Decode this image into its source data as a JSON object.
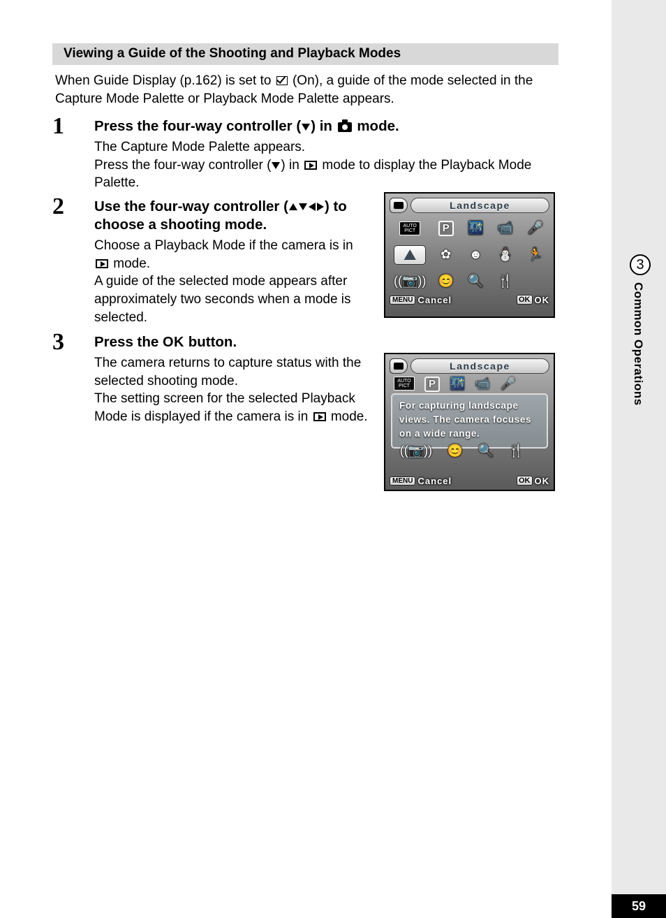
{
  "sideTab": {
    "chapter": "3",
    "label": "Common Operations"
  },
  "pageNumber": "59",
  "sectionHeader": "Viewing a Guide of the Shooting and Playback Modes",
  "intro": {
    "part1": "When Guide Display (p.162) is set to ",
    "part2": " (On), a guide of the mode selected in the Capture Mode Palette or Playback Mode Palette appears."
  },
  "steps": [
    {
      "num": "1",
      "title_a": "Press the four-way controller (",
      "title_b": ") in ",
      "title_c": " mode.",
      "desc_a": "The Capture Mode Palette appears.",
      "desc_b1": "Press the four-way controller (",
      "desc_b2": ") in ",
      "desc_b3": " mode to display the Playback Mode Palette."
    },
    {
      "num": "2",
      "title_a": "Use the four-way controller (",
      "title_b": ") to choose a shooting mode.",
      "desc_a1": "Choose a Playback Mode if the camera is in ",
      "desc_a2": " mode.",
      "desc_b": "A guide of the selected mode appears after approximately two seconds when a mode is selected."
    },
    {
      "num": "3",
      "title_a": "Press the ",
      "title_ok": "OK",
      "title_b": " button.",
      "desc_a": "The camera returns to capture status with the selected shooting mode.",
      "desc_b1": "The setting screen for the selected Playback Mode is displayed if the camera is in ",
      "desc_b2": " mode."
    }
  ],
  "lcd": {
    "title": "Landscape",
    "autopict": "AUTO\nPICT",
    "p": "P",
    "guideText": "For capturing landscape views. The camera focuses on a wide range.",
    "menuBadge": "MENU",
    "cancel": "Cancel",
    "okBadge": "OK",
    "okText": "OK",
    "mountain": "⛰",
    "icons_row1": [
      "",
      "P",
      "🌃",
      "🏚",
      "🎤"
    ],
    "icons_row2": [
      "⛰",
      "✿",
      "☺",
      "⛄",
      "🏃"
    ],
    "icons_row3": [
      "📡",
      "😊",
      "🔍",
      "🍴",
      ""
    ]
  }
}
